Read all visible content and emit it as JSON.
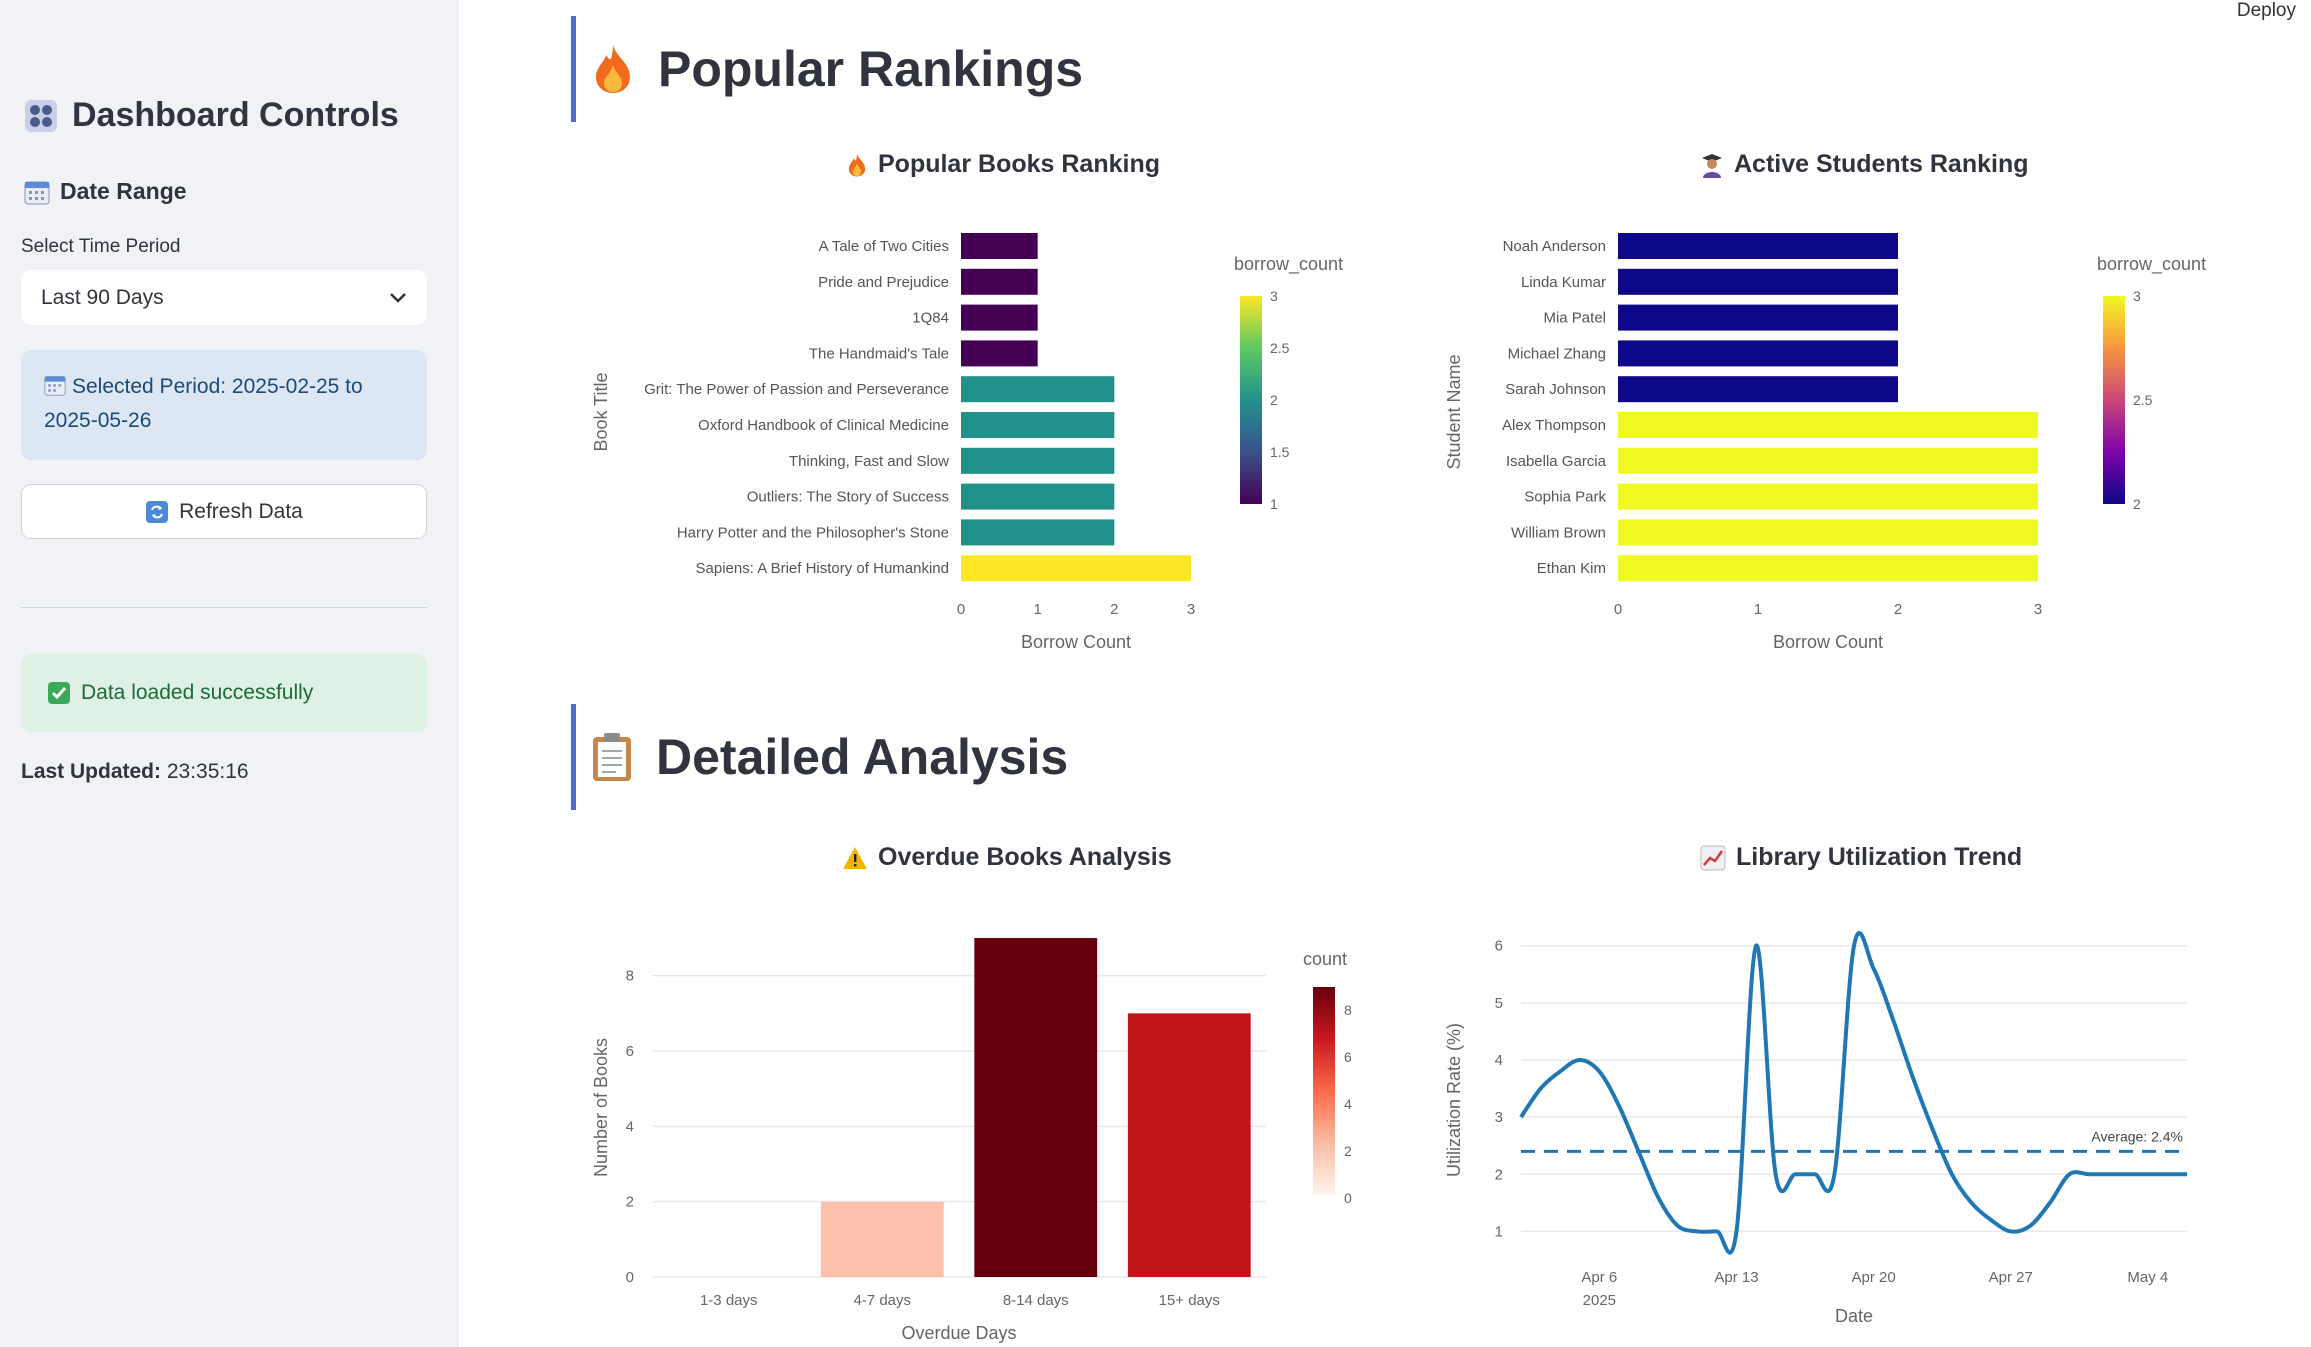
{
  "deploy_label": "Deploy",
  "sidebar": {
    "title": "Dashboard Controls",
    "date_range_heading": "Date Range",
    "period_label": "Select Time Period",
    "period_value": "Last 90 Days",
    "selected_period": "Selected Period: 2025-02-25 to 2025-05-26",
    "refresh_label": "Refresh Data",
    "success_message": "Data loaded successfully",
    "last_updated_label": "Last Updated:",
    "last_updated_value": "23:35:16"
  },
  "sections": {
    "rankings_title": "Popular Rankings",
    "analysis_title": "Detailed Analysis"
  },
  "charts": {
    "books_title": "Popular Books Ranking",
    "students_title": "Active Students Ranking",
    "overdue_title": "Overdue Books Analysis",
    "trend_title": "Library Utilization Trend"
  },
  "colors": {
    "accent": "#4f6bd6",
    "trend_line": "#1f77b4",
    "sidebar_bg": "#f0f2f6"
  },
  "chart_data": [
    {
      "type": "bar",
      "orientation": "horizontal",
      "title": "Popular Books Ranking",
      "xlabel": "Borrow Count",
      "ylabel": "Book Title",
      "categories": [
        "A Tale of Two Cities",
        "Pride and Prejudice",
        "1Q84",
        "The Handmaid's Tale",
        "Grit: The Power of Passion and Perseverance",
        "Oxford Handbook of Clinical Medicine",
        "Thinking, Fast and Slow",
        "Outliers: The Story of Success",
        "Harry Potter and the Philosopher's Stone",
        "Sapiens: A Brief History of Humankind"
      ],
      "values": [
        1,
        1,
        1,
        1,
        2,
        2,
        2,
        2,
        2,
        3
      ],
      "xlim": [
        0,
        3
      ],
      "xticks": [
        "0",
        "1",
        "2",
        "3"
      ],
      "colorscale": "viridis",
      "colorbar": {
        "title": "borrow_count",
        "ticks": [
          "3",
          "2.5",
          "2",
          "1.5",
          "1"
        ]
      }
    },
    {
      "type": "bar",
      "orientation": "horizontal",
      "title": "Active Students Ranking",
      "xlabel": "Borrow Count",
      "ylabel": "Student Name",
      "categories": [
        "Noah Anderson",
        "Linda Kumar",
        "Mia Patel",
        "Michael Zhang",
        "Sarah Johnson",
        "Alex Thompson",
        "Isabella Garcia",
        "Sophia Park",
        "William Brown",
        "Ethan Kim"
      ],
      "values": [
        2,
        2,
        2,
        2,
        2,
        3,
        3,
        3,
        3,
        3
      ],
      "xlim": [
        0,
        3
      ],
      "xticks": [
        "0",
        "1",
        "2",
        "3"
      ],
      "colorscale": "plasma",
      "colorbar": {
        "title": "borrow_count",
        "ticks": [
          "3",
          "2.5",
          "2"
        ]
      }
    },
    {
      "type": "bar",
      "title": "Overdue Books Analysis",
      "xlabel": "Overdue Days",
      "ylabel": "Number of Books",
      "categories": [
        "1-3 days",
        "4-7 days",
        "8-14 days",
        "15+ days"
      ],
      "values": [
        0,
        2,
        9,
        7
      ],
      "ylim": [
        0,
        9
      ],
      "yticks": [
        "0",
        "2",
        "4",
        "6",
        "8"
      ],
      "colorscale": "reds",
      "colorbar": {
        "title": "count",
        "ticks": [
          "8",
          "6",
          "4",
          "2",
          "0"
        ]
      }
    },
    {
      "type": "line",
      "title": "Library Utilization Trend",
      "xlabel": "Date",
      "ylabel": "Utilization Rate (%)",
      "xticks": [
        "Apr 6",
        "Apr 13",
        "Apr 20",
        "Apr 27",
        "May 4"
      ],
      "xtick_sub": "2025",
      "yticks": [
        "1",
        "2",
        "3",
        "4",
        "5",
        "6"
      ],
      "ylim": [
        0.5,
        6.1
      ],
      "x": [
        "2025-04-02",
        "2025-04-03",
        "2025-04-04",
        "2025-04-05",
        "2025-04-06",
        "2025-04-07",
        "2025-04-08",
        "2025-04-09",
        "2025-04-10",
        "2025-04-11",
        "2025-04-12",
        "2025-04-13",
        "2025-04-14",
        "2025-04-15",
        "2025-04-16",
        "2025-04-17",
        "2025-04-18",
        "2025-04-19",
        "2025-04-20",
        "2025-04-21",
        "2025-04-22",
        "2025-04-23",
        "2025-04-24",
        "2025-04-25",
        "2025-04-26",
        "2025-04-27",
        "2025-04-28",
        "2025-04-29",
        "2025-04-30",
        "2025-05-01",
        "2025-05-02",
        "2025-05-03",
        "2025-05-04",
        "2025-05-05",
        "2025-05-06"
      ],
      "values": [
        3,
        3.5,
        3.8,
        4,
        3.8,
        3.2,
        2.4,
        1.6,
        1.1,
        1,
        1,
        1,
        6,
        2,
        2,
        2,
        2,
        6,
        5.6,
        4.7,
        3.7,
        2.8,
        2,
        1.5,
        1.2,
        1,
        1.1,
        1.5,
        2,
        2,
        2,
        2,
        2,
        2,
        2
      ],
      "average": 2.4,
      "average_label": "Average: 2.4%"
    }
  ]
}
